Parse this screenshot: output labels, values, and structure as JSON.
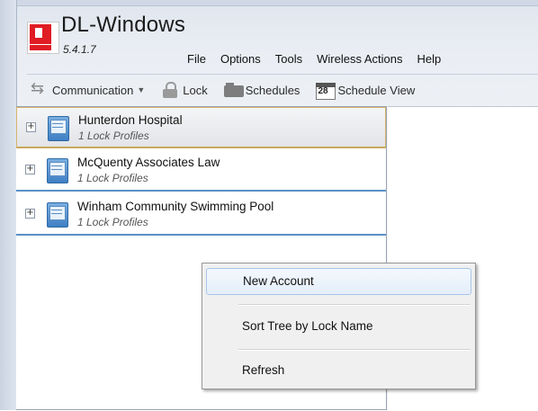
{
  "app": {
    "title": "DL-Windows",
    "version": "5.4.1.7"
  },
  "menubar": {
    "items": [
      "File",
      "Options",
      "Tools",
      "Wireless Actions",
      "Help"
    ]
  },
  "toolbar": {
    "communication": "Communication",
    "lock": "Lock",
    "schedules": "Schedules",
    "schedule_view": "Schedule View",
    "calendar_number": "28"
  },
  "tree": {
    "accounts": [
      {
        "name": "Hunterdon Hospital",
        "sub": "1 Lock Profiles",
        "selected": true
      },
      {
        "name": "McQuenty Associates Law",
        "sub": "1 Lock Profiles",
        "selected": false
      },
      {
        "name": "Winham Community Swimming Pool",
        "sub": "1 Lock Profiles",
        "selected": false
      }
    ],
    "expander_symbol": "+"
  },
  "context_menu": {
    "items": [
      "New Account",
      "Sort Tree by Lock Name",
      "Refresh"
    ],
    "highlighted": "New Account"
  },
  "colors": {
    "accent_blue": "#5a8fc8",
    "logo_red": "#e01c24",
    "selection_border": "#d7b56b"
  }
}
